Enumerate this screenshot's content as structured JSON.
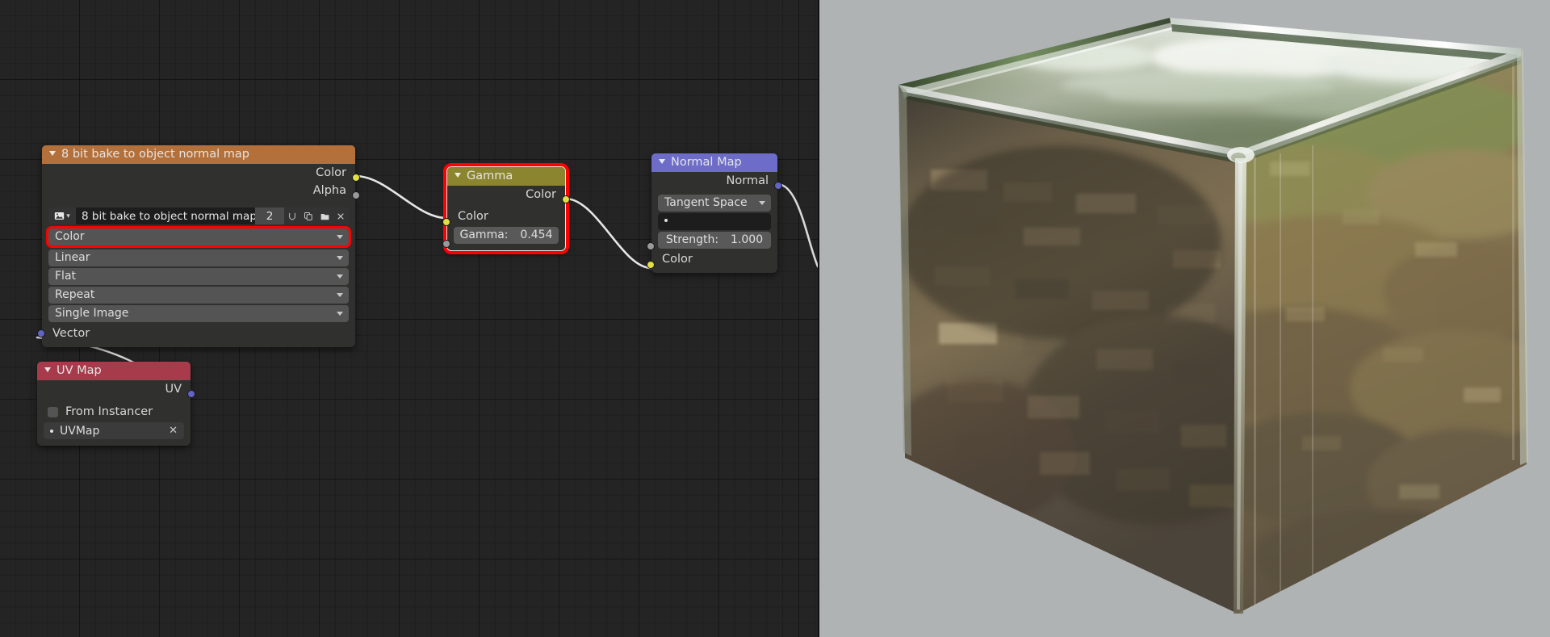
{
  "app": {
    "name": "Blender Shader Editor"
  },
  "colors": {
    "editor_background": "#242424",
    "viewport_background": "#b0b3b4",
    "node_body": "#30302f",
    "header_texture": "#b4703a",
    "header_converter": "#8c8530",
    "header_input": "#a83b4b",
    "header_vector": "#6d6dc9",
    "socket_color": "#e0e043",
    "socket_gray": "#9a9a9a",
    "socket_vector": "#6363c7",
    "highlight": "#ff0000",
    "noodle": "#e6e6e6"
  },
  "nodes": {
    "image_texture": {
      "title": "8 bit bake to object normal map",
      "outputs": [
        {
          "label": "Color",
          "socket": "color"
        },
        {
          "label": "Alpha",
          "socket": "gray"
        }
      ],
      "datablock": {
        "browse_icon": "image-browse-icon",
        "name": "8 bit bake to object normal map",
        "users": "2",
        "fake_user_icon": "fake-user-shield-icon",
        "duplicate_icon": "duplicate-icon",
        "open_icon": "open-folder-icon",
        "unlink_icon": "unlink-x-icon"
      },
      "dropdowns": [
        {
          "value": "Color",
          "name": "color-space-alpha-dropdown",
          "highlighted": true
        },
        {
          "value": "Linear",
          "name": "interpolation-dropdown",
          "highlighted": false
        },
        {
          "value": "Flat",
          "name": "projection-dropdown",
          "highlighted": false
        },
        {
          "value": "Repeat",
          "name": "extension-dropdown",
          "highlighted": false
        },
        {
          "value": "Single Image",
          "name": "source-dropdown",
          "highlighted": false
        }
      ],
      "inputs": [
        {
          "label": "Vector",
          "socket": "vector"
        }
      ]
    },
    "uv_map": {
      "title": "UV Map",
      "outputs": [
        {
          "label": "UV",
          "socket": "vector"
        }
      ],
      "checkbox": {
        "label": "From Instancer",
        "checked": false
      },
      "uv_field": {
        "value": "UVMap",
        "clear_icon": "x-icon"
      }
    },
    "gamma": {
      "title": "Gamma",
      "selected": true,
      "highlighted": true,
      "outputs": [
        {
          "label": "Color",
          "socket": "color"
        }
      ],
      "inputs": [
        {
          "label": "Color",
          "socket": "color"
        },
        {
          "label": "Gamma:",
          "value": "0.454",
          "socket": "gray"
        }
      ]
    },
    "normal_map": {
      "title": "Normal Map",
      "outputs": [
        {
          "label": "Normal",
          "socket": "vector"
        }
      ],
      "space_dropdown": {
        "value": "Tangent Space"
      },
      "uv_map_field": {
        "value": ""
      },
      "strength": {
        "label": "Strength:",
        "value": "1.000",
        "socket": "gray"
      },
      "color_input": {
        "label": "Color",
        "socket": "color"
      }
    }
  },
  "viewport": {
    "shading": "rendered-preview",
    "object": "cube",
    "description": "Shiny beveled cube with reflective metal material showing outdoor environment reflection"
  }
}
